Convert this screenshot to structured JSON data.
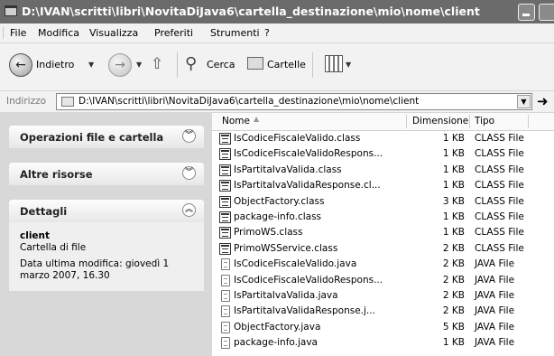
{
  "window": {
    "title": "D:\\IVAN\\scritti\\libri\\NovitaDiJava6\\cartella_destinazione\\mio\\nome\\client"
  },
  "menu": [
    "File",
    "Modifica",
    "Visualizza",
    "Preferiti",
    "Strumenti",
    "?"
  ],
  "toolbar": {
    "back_label": "Indietro",
    "search_label": "Cerca",
    "folders_label": "Cartelle"
  },
  "address": {
    "label": "Indirizzo",
    "value": "D:\\IVAN\\scritti\\libri\\NovitaDiJava6\\cartella_destinazione\\mio\\nome\\client"
  },
  "sidebar": {
    "panels": [
      {
        "title": "Operazioni file e cartella",
        "state": "collapsed"
      },
      {
        "title": "Altre risorse",
        "state": "collapsed"
      },
      {
        "title": "Dettagli",
        "state": "expanded"
      }
    ],
    "details": {
      "name": "client",
      "kind": "Cartella di file",
      "modified": "Data ultima modifica: giovedì 1 marzo 2007, 16.30"
    }
  },
  "filelist": {
    "columns": {
      "name": "Nome",
      "size": "Dimensione",
      "type": "Tipo"
    },
    "files": [
      {
        "name": "IsCodiceFiscaleValido.class",
        "size": "1 KB",
        "type": "CLASS File",
        "icon": "class-file-icon"
      },
      {
        "name": "IsCodiceFiscaleValidoRespons...",
        "size": "1 KB",
        "type": "CLASS File",
        "icon": "class-file-icon"
      },
      {
        "name": "IsPartitaIvaValida.class",
        "size": "1 KB",
        "type": "CLASS File",
        "icon": "class-file-icon"
      },
      {
        "name": "IsPartitaIvaValidaResponse.cl...",
        "size": "1 KB",
        "type": "CLASS File",
        "icon": "class-file-icon"
      },
      {
        "name": "ObjectFactory.class",
        "size": "3 KB",
        "type": "CLASS File",
        "icon": "class-file-icon"
      },
      {
        "name": "package-info.class",
        "size": "1 KB",
        "type": "CLASS File",
        "icon": "class-file-icon"
      },
      {
        "name": "PrimoWS.class",
        "size": "1 KB",
        "type": "CLASS File",
        "icon": "class-file-icon"
      },
      {
        "name": "PrimoWSService.class",
        "size": "2 KB",
        "type": "CLASS File",
        "icon": "class-file-icon"
      },
      {
        "name": "IsCodiceFiscaleValido.java",
        "size": "2 KB",
        "type": "JAVA File",
        "icon": "java-file-icon"
      },
      {
        "name": "IsCodiceFiscaleValidoRespons...",
        "size": "2 KB",
        "type": "JAVA File",
        "icon": "java-file-icon"
      },
      {
        "name": "IsPartitaIvaValida.java",
        "size": "2 KB",
        "type": "JAVA File",
        "icon": "java-file-icon"
      },
      {
        "name": "IsPartitaIvaValidaResponse.j...",
        "size": "2 KB",
        "type": "JAVA File",
        "icon": "java-file-icon"
      },
      {
        "name": "ObjectFactory.java",
        "size": "5 KB",
        "type": "JAVA File",
        "icon": "java-file-icon"
      },
      {
        "name": "package-info.java",
        "size": "1 KB",
        "type": "JAVA File",
        "icon": "java-file-icon"
      }
    ]
  }
}
